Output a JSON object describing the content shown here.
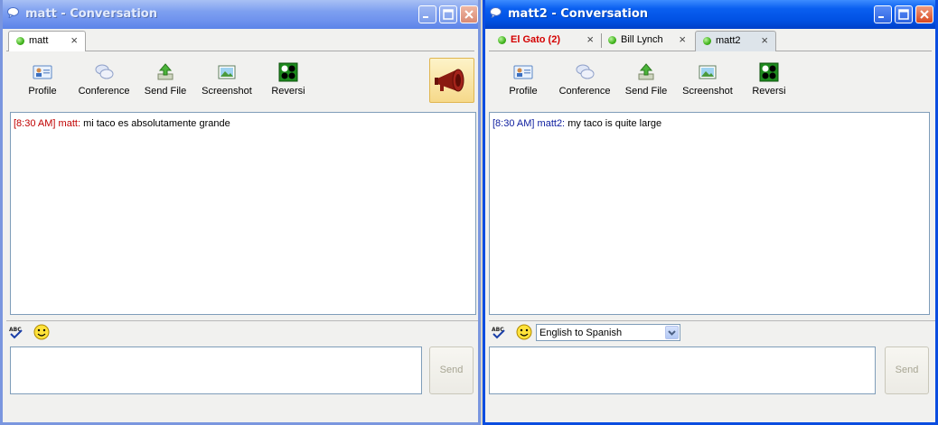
{
  "windows": [
    {
      "title": "matt - Conversation",
      "tabs": [
        {
          "label": "matt",
          "close": "×"
        }
      ],
      "toolbar": [
        {
          "label": "Profile",
          "icon": "profile-icon"
        },
        {
          "label": "Conference",
          "icon": "conference-icon"
        },
        {
          "label": "Send File",
          "icon": "send-file-icon"
        },
        {
          "label": "Screenshot",
          "icon": "screenshot-icon"
        },
        {
          "label": "Reversi",
          "icon": "reversi-icon"
        }
      ],
      "message": {
        "time": "[8:30 AM]",
        "nick": "matt:",
        "text": "mi taco es absolutamente grande",
        "color": "#c00000"
      },
      "send_label": "Send"
    },
    {
      "title": "matt2 - Conversation",
      "tabs": [
        {
          "label": "El Gato (2)",
          "close": "×",
          "highlight": "#d40000"
        },
        {
          "label": "Bill Lynch",
          "close": "×"
        },
        {
          "label": "matt2",
          "close": "×"
        }
      ],
      "toolbar": [
        {
          "label": "Profile",
          "icon": "profile-icon"
        },
        {
          "label": "Conference",
          "icon": "conference-icon"
        },
        {
          "label": "Send File",
          "icon": "send-file-icon"
        },
        {
          "label": "Screenshot",
          "icon": "screenshot-icon"
        },
        {
          "label": "Reversi",
          "icon": "reversi-icon"
        }
      ],
      "message": {
        "time": "[8:30 AM]",
        "nick": "matt2:",
        "text": "my taco is quite large",
        "color": "#1020a0"
      },
      "translation": {
        "selected": "English to Spanish"
      },
      "send_label": "Send"
    }
  ]
}
